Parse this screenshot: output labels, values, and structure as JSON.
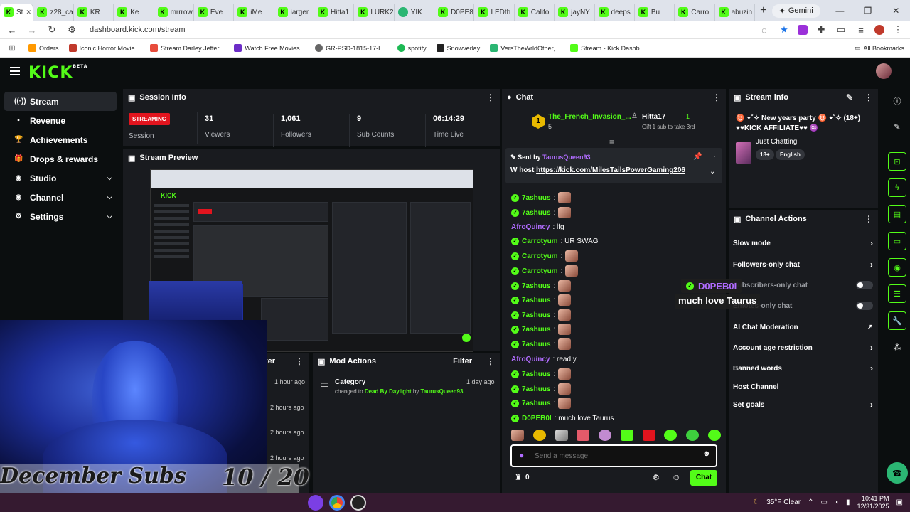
{
  "browser": {
    "tabs": [
      "St",
      "z28_ca",
      "KR",
      "Ke",
      "mrrrow",
      "Eve",
      "iMe",
      "iarger",
      "Hitta1",
      "LURK2",
      "YIK",
      "D0PE8",
      "LEDth",
      "Califo",
      "jayNY",
      "deeps",
      "Bu",
      "Carro",
      "abuzin"
    ],
    "gemini_label": "Gemini",
    "url": "dashboard.kick.com/stream",
    "bookmarks": [
      "Orders",
      "Iconic Horror Movie...",
      "Stream Darley Jeffer...",
      "Watch Free Movies...",
      "GR-PSD-1815-17-L...",
      "spotify",
      "Snowverlay",
      "VersTheWrldOther,...",
      "Stream - Kick Dashb..."
    ],
    "all_bookmarks": "All Bookmarks"
  },
  "app": {
    "logo": "KICK",
    "logo_sup": "BETA"
  },
  "sidenav": [
    {
      "label": "Stream",
      "icon": "((·))",
      "active": true
    },
    {
      "label": "Revenue",
      "icon": "▪"
    },
    {
      "label": "Achievements",
      "icon": "🏆"
    },
    {
      "label": "Drops & rewards",
      "icon": "🎁"
    },
    {
      "label": "Studio",
      "icon": "◉",
      "chevron": "v"
    },
    {
      "label": "Channel",
      "icon": "◉",
      "chevron": "v"
    },
    {
      "label": "Settings",
      "icon": "⚙",
      "chevron": "v"
    }
  ],
  "session": {
    "title": "Session Info",
    "status": "STREAMING",
    "status_label": "Session",
    "viewers": "31",
    "viewers_label": "Viewers",
    "followers": "1,061",
    "followers_label": "Followers",
    "subs": "9",
    "subs_label": "Sub Counts",
    "time": "06:14:29",
    "time_label": "Time Live"
  },
  "preview": {
    "title": "Stream Preview"
  },
  "activity": {
    "filter": "Filter",
    "times": [
      "1 hour ago",
      "2 hours ago",
      "2 hours ago",
      "2 hours ago"
    ]
  },
  "mod_actions": {
    "title": "Mod Actions",
    "filter": "Filter",
    "item_title": "Category",
    "item_time": "1 day ago",
    "item_changed": "changed to",
    "item_game": "Dead By Daylight",
    "item_by": "by",
    "item_user": "TaurusQueen93"
  },
  "chat": {
    "title": "Chat",
    "top_gifter_1": "The_French_Invasion_...",
    "top_gifter_1_count": "5",
    "top_gifter_rank": "1",
    "top_gifter_2": "Hitta17",
    "top_gifter_2_count": "1",
    "gift_note": "Gift 1 sub to take 3rd",
    "pinned_sent_by": "Sent by",
    "pinned_user": "TaurusQueen93",
    "pinned_msg_prefix": "W host",
    "pinned_link": "https://kick.com/MilesTailsPowerGaming206",
    "messages": [
      {
        "user": "7ashuus",
        "text": ":",
        "color": "g"
      },
      {
        "user": "7ashuus",
        "text": ":",
        "color": "g"
      },
      {
        "user": "AfroQuincy",
        "text": ": lfg",
        "color": "p"
      },
      {
        "user": "Carrotyum",
        "text": ": UR SWAG",
        "color": "g"
      },
      {
        "user": "Carrotyum",
        "text": ":",
        "color": "g"
      },
      {
        "user": "Carrotyum",
        "text": ":",
        "color": "g"
      },
      {
        "user": "7ashuus",
        "text": ":",
        "color": "g"
      },
      {
        "user": "7ashuus",
        "text": ":",
        "color": "g"
      },
      {
        "user": "7ashuus",
        "text": ":",
        "color": "g"
      },
      {
        "user": "7ashuus",
        "text": ":",
        "color": "g"
      },
      {
        "user": "7ashuus",
        "text": ":",
        "color": "g"
      },
      {
        "user": "AfroQuincy",
        "text": ": read y",
        "color": "p"
      },
      {
        "user": "7ashuus",
        "text": ":",
        "color": "g"
      },
      {
        "user": "7ashuus",
        "text": ":",
        "color": "g"
      },
      {
        "user": "7ashuus",
        "text": ":",
        "color": "g"
      },
      {
        "user": "D0PEB0I",
        "text": ": much love Taurus",
        "color": "g"
      }
    ],
    "placeholder": "Send a message",
    "points": "0",
    "send_label": "Chat"
  },
  "stream_info": {
    "title": "Stream info",
    "stream_title": "♉ ⋆˚✧ New years party ♉ ⋆˚✧ (18+)",
    "stream_title_2": "♥♥KICK AFFILIATE♥♥ ♒",
    "category": "Just Chatting",
    "tag1": "18+",
    "tag2": "English"
  },
  "channel_actions": {
    "title": "Channel Actions",
    "items": [
      {
        "label": "Slow mode",
        "kind": "arrow"
      },
      {
        "label": "Followers-only chat",
        "kind": "arrow"
      },
      {
        "label": "Subscribers-only chat",
        "kind": "toggle"
      },
      {
        "label": "Emotes-only chat",
        "kind": "toggle"
      },
      {
        "label": "AI Chat Moderation",
        "kind": "ext"
      },
      {
        "label": "Account age restriction",
        "kind": "arrow"
      },
      {
        "label": "Banned words",
        "kind": "arrow"
      },
      {
        "label": "Host Channel",
        "kind": "none"
      },
      {
        "label": "Set goals",
        "kind": "arrow"
      }
    ]
  },
  "overlay": {
    "chat_user": "D0PEB0I",
    "chat_msg": "much love Taurus",
    "subs_label": "December Subs",
    "subs_count": "10 / 20",
    "subs_goal": 20,
    "subs_current": 10
  },
  "taskbar": {
    "weather": "35°F  Clear",
    "time": "10:41 PM",
    "date": "12/31/2025"
  },
  "colors": {
    "brand": "#53fc18",
    "panel": "#191b1f",
    "live": "#e2141e"
  }
}
